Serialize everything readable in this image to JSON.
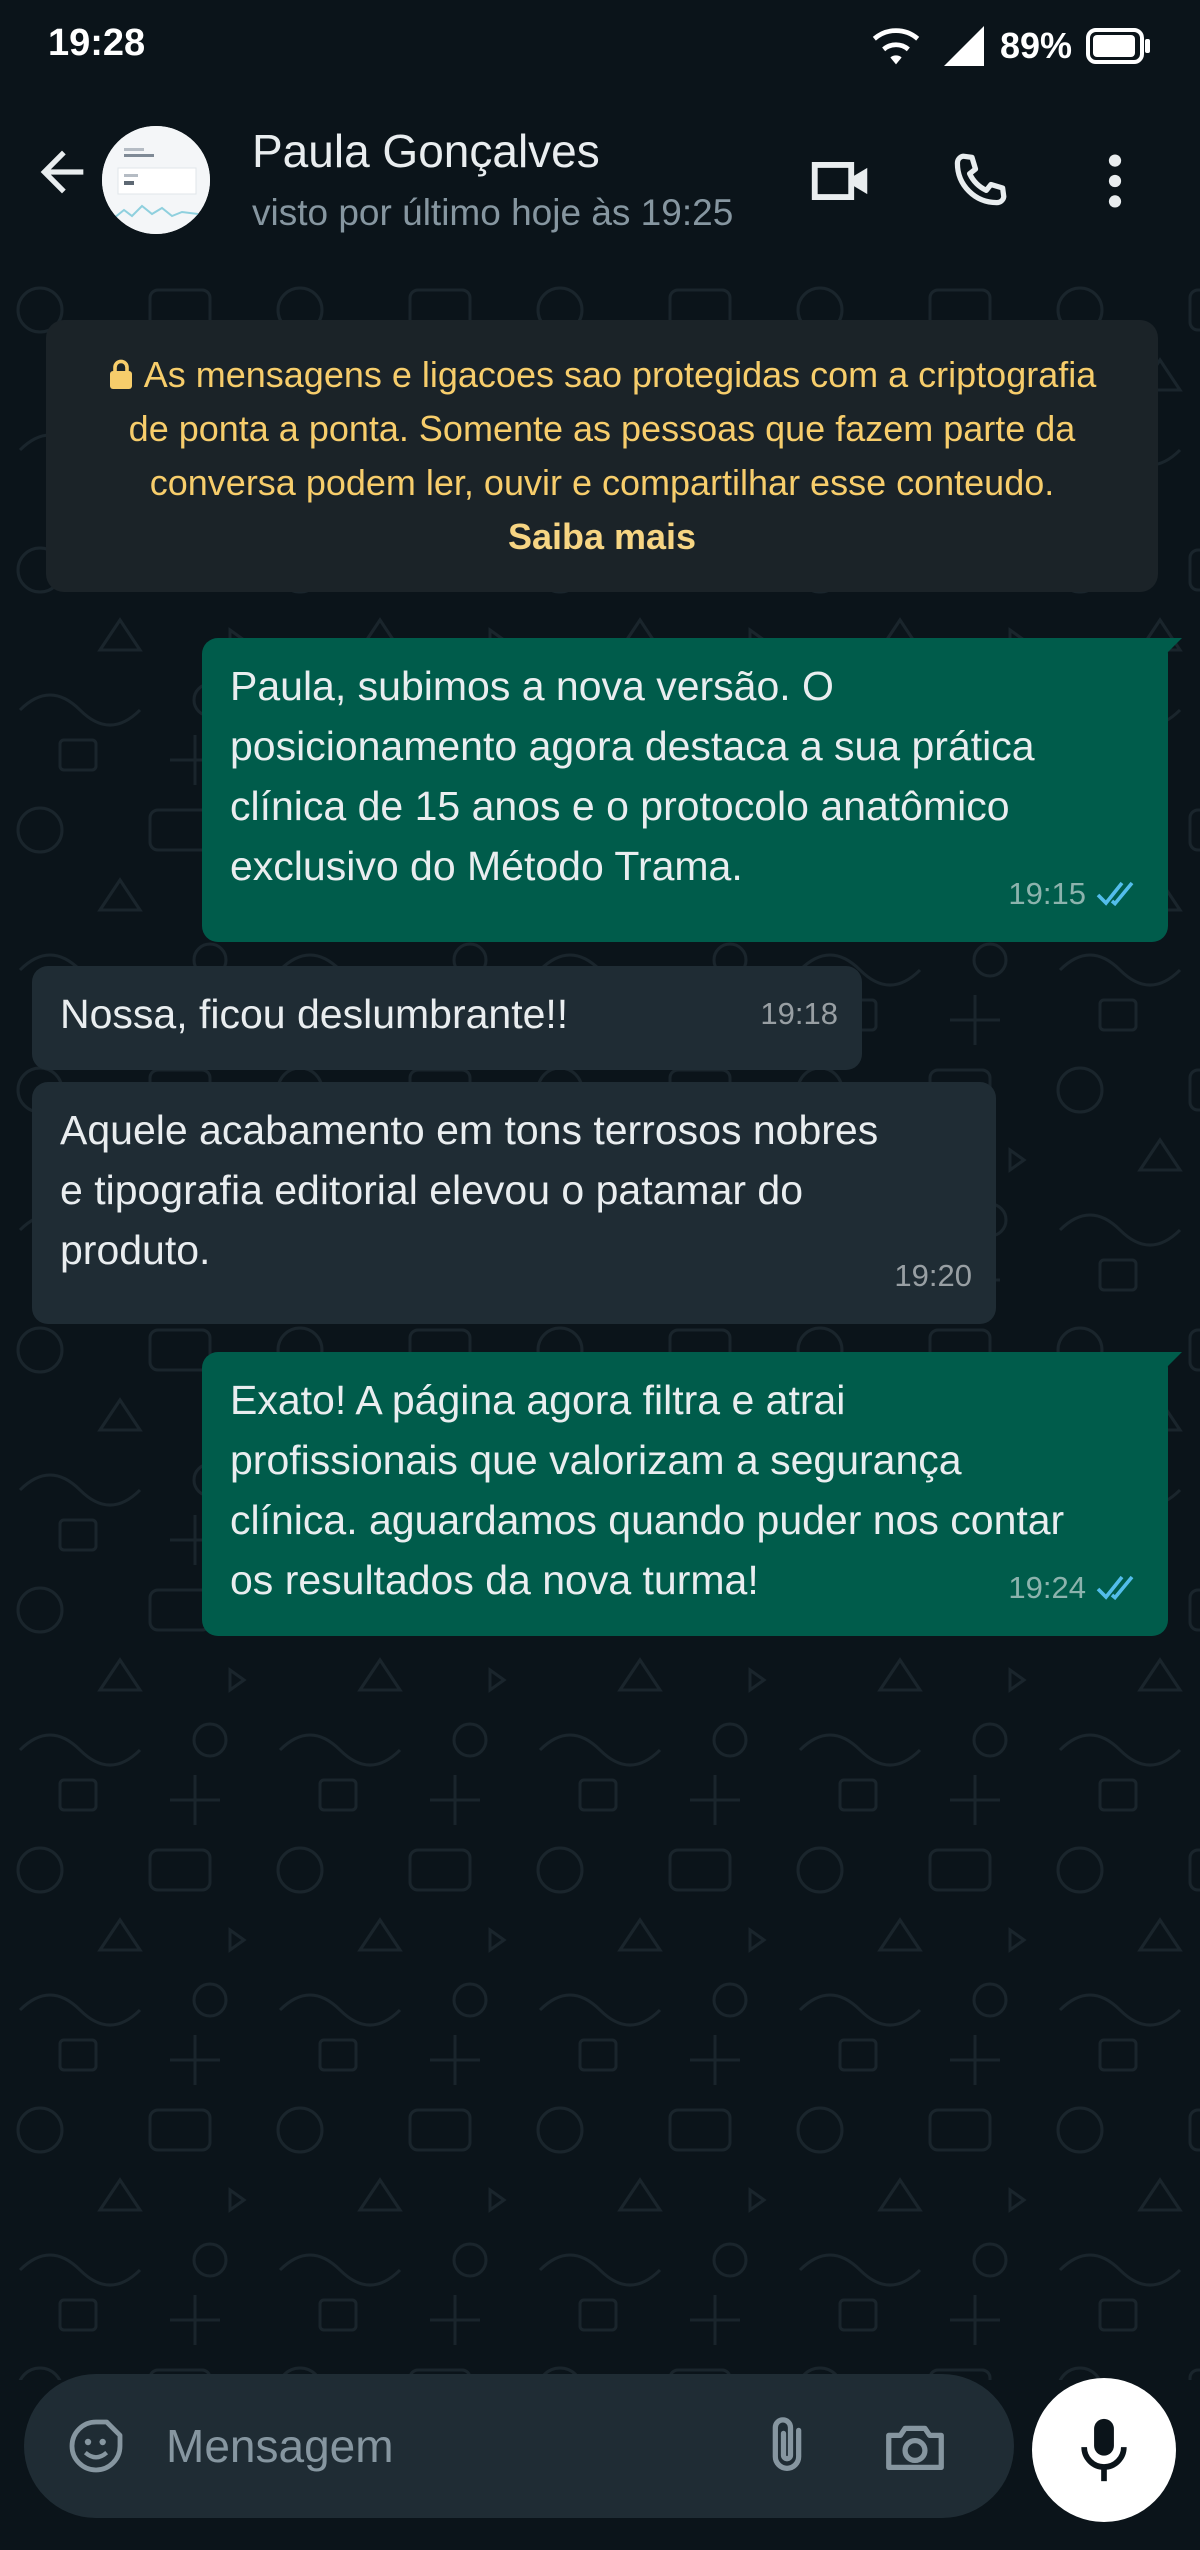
{
  "status_bar": {
    "time": "19:28",
    "battery_percent": "89%",
    "icons": [
      "wifi-icon",
      "signal-icon",
      "battery-icon"
    ]
  },
  "header": {
    "contact_name": "Paula Gonçalves",
    "contact_status": "visto por último hoje às 19:25",
    "icons": [
      "back-arrow-icon",
      "video-call-icon",
      "voice-call-icon",
      "more-vert-icon"
    ]
  },
  "encryption_notice": {
    "text": "As mensagens e ligacoes sao protegidas com a criptografia de ponta a ponta. Somente as pessoas que fazem parte da conversa podem ler, ouvir e compartilhar esse conteudo.",
    "link": "Saiba mais"
  },
  "messages": [
    {
      "direction": "out",
      "text": "Paula, subimos a nova versão. O\nposicionamento agora destaca a sua prática\nclínica de 15 anos e o protocolo anatômico\nexclusivo do Método Trama.",
      "time": "19:15",
      "status": "read"
    },
    {
      "direction": "in",
      "text": "Nossa, ficou deslumbrante!!",
      "time": "19:18"
    },
    {
      "direction": "in",
      "text": "Aquele acabamento em tons terrosos nobres\ne tipografia editorial elevou o patamar do\nproduto.",
      "time": "19:20"
    },
    {
      "direction": "out",
      "text": "Exato! A página agora filtra e atrai\nprofissionais que valorizam a segurança\nclínica. aguardamos quando puder nos contar\nos resultados da nova turma!",
      "time": "19:24",
      "status": "read"
    }
  ],
  "composer": {
    "placeholder": "Mensagem",
    "icons": [
      "sticker-emoji-icon",
      "paperclip-icon",
      "camera-icon",
      "microphone-icon"
    ]
  },
  "colors": {
    "background": "#0b141a",
    "outgoing_bubble": "#005c4b",
    "incoming_bubble": "#1f2c34",
    "notice_text": "#f7cd6b",
    "read_ticks": "#53bdeb"
  }
}
